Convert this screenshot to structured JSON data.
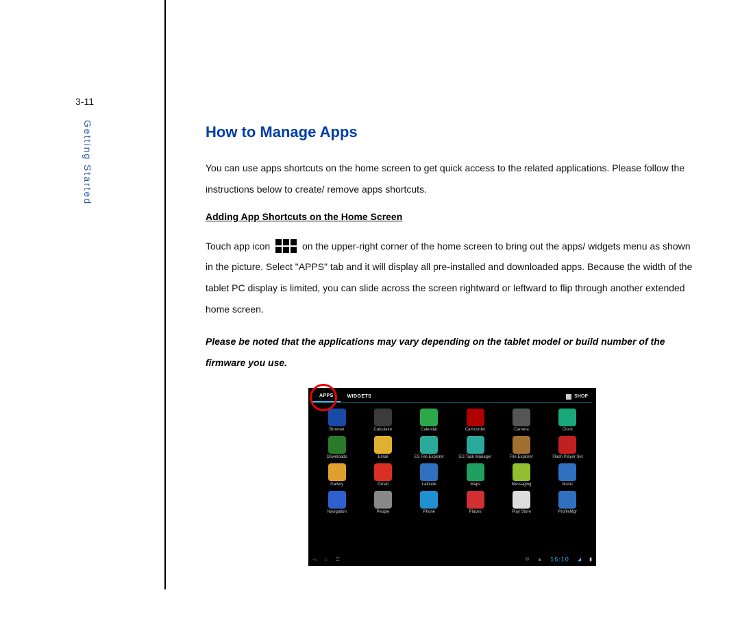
{
  "page_number": "3-11",
  "section_label": "Getting Started",
  "title": "How to Manage Apps",
  "intro": "You can use apps shortcuts on the home screen to get quick access to the related applications. Please follow the instructions below to create/ remove apps shortcuts.",
  "subheading": "Adding App Shortcuts on the Home Screen",
  "body_before_icon": "Touch app icon",
  "body_after_icon": "on the upper-right corner of the home screen to bring out the apps/ widgets menu as shown in the picture. Select \"APPS\" tab and it will display all pre-installed and downloaded apps. Because the width of the tablet PC display is limited, you can slide across the screen rightward or leftward to flip through another extended home screen.",
  "note": "Please be noted that the applications may vary depending on the tablet model or build number of the firmware you use.",
  "tablet": {
    "tabs": {
      "apps": "APPS",
      "widgets": "WIDGETS",
      "shop": "SHOP"
    },
    "apps": [
      {
        "label": "Browser",
        "color": "#1a4aa8"
      },
      {
        "label": "Calculator",
        "color": "#3b3b3b"
      },
      {
        "label": "Calendar",
        "color": "#2aa84a"
      },
      {
        "label": "Camcorder",
        "color": "#b00000"
      },
      {
        "label": "Camera",
        "color": "#555555"
      },
      {
        "label": "Clock",
        "color": "#1aa87a"
      },
      {
        "label": "Downloads",
        "color": "#2a7a2a"
      },
      {
        "label": "Email",
        "color": "#e0b030"
      },
      {
        "label": "ES File Explorer",
        "color": "#2aa89a"
      },
      {
        "label": "ES Task Manager",
        "color": "#2aa89a"
      },
      {
        "label": "File Explorer",
        "color": "#a07030"
      },
      {
        "label": "Flash Player Set",
        "color": "#c02020"
      },
      {
        "label": "Gallery",
        "color": "#e0a030"
      },
      {
        "label": "Gmail",
        "color": "#d93025"
      },
      {
        "label": "Latitude",
        "color": "#3070c0"
      },
      {
        "label": "Maps",
        "color": "#20a060"
      },
      {
        "label": "Messaging",
        "color": "#90c030"
      },
      {
        "label": "Music",
        "color": "#3070c0"
      },
      {
        "label": "Navigation",
        "color": "#3060d0"
      },
      {
        "label": "People",
        "color": "#888888"
      },
      {
        "label": "Phone",
        "color": "#2090d0"
      },
      {
        "label": "Places",
        "color": "#d03030"
      },
      {
        "label": "Play Store",
        "color": "#dddddd"
      },
      {
        "label": "ProfileMgr",
        "color": "#3070c0"
      }
    ],
    "clock": "16:10"
  }
}
